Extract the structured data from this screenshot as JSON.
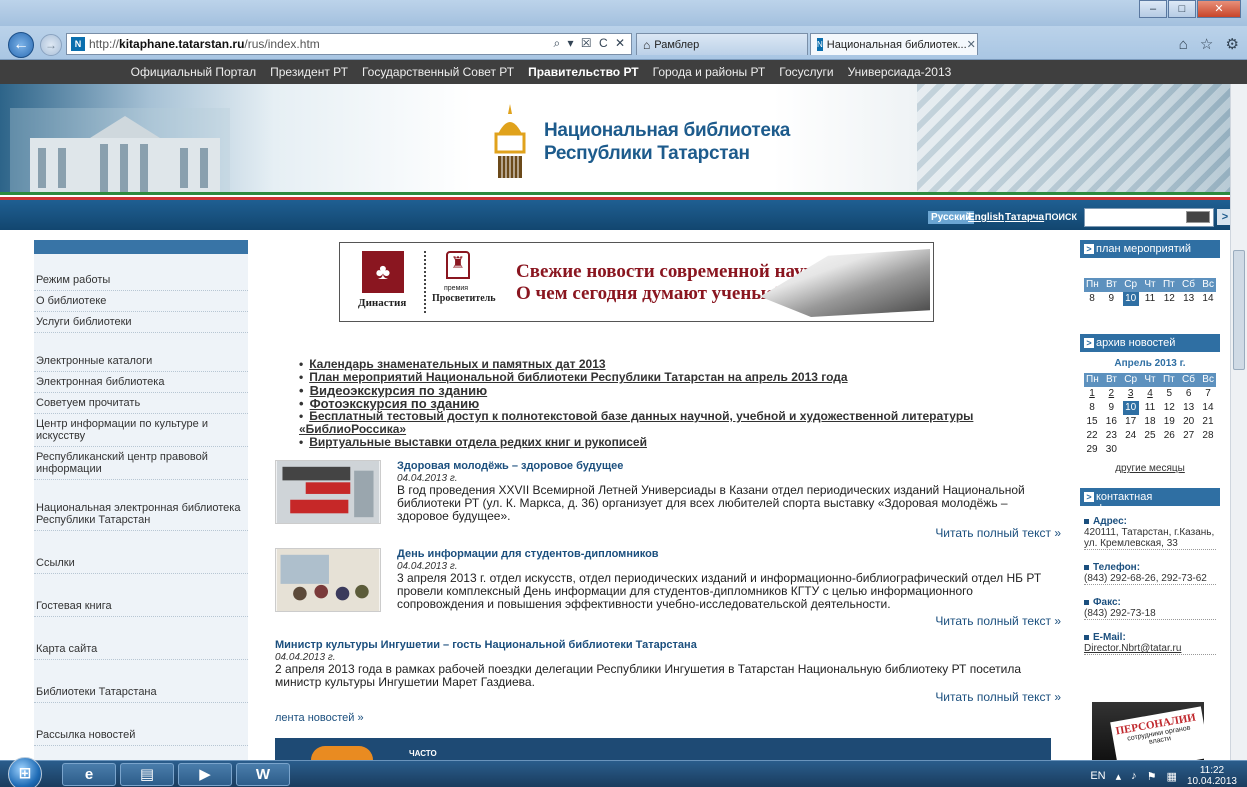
{
  "browser": {
    "url_prefix": "http://",
    "url_host": "kitaphane.tatarstan.ru",
    "url_path": "/rus/index.htm",
    "url_tools": "⌕ ▾ ☒ C ✕",
    "tabs": [
      {
        "label": "Рамблер",
        "active": false
      },
      {
        "label": "Национальная библиотек...",
        "active": true
      }
    ],
    "tab_close": "✕",
    "window_controls": [
      "–",
      "□",
      "✕"
    ],
    "right_icons": "⌂ ☆ ⚙"
  },
  "topnav": {
    "items": [
      "Официальный Портал",
      "Президент РТ",
      "Государственный Совет РТ",
      "Правительство РТ",
      "Города и районы РТ",
      "Госуслуги",
      "Универсиада-2013"
    ],
    "active_index": 3
  },
  "banner": {
    "title_line1": "Национальная библиотека",
    "title_line2": "Республики Татарстан"
  },
  "langbar": {
    "ru": "Русский",
    "en": "English",
    "tt": "Татарча",
    "search_label": "ПОИСК",
    "search_value": "",
    "go": ">"
  },
  "sidebar": {
    "group1": [
      "Режим работы",
      "О библиотеке",
      "Услуги библиотеки"
    ],
    "group2": [
      "Электронные каталоги",
      "Электронная библиотека",
      "Советуем прочитать",
      "Центр информации по культуре и искусству",
      "Республиканский центр правовой информации"
    ],
    "group3": [
      "Национальная электронная библиотека Республики Татарстан"
    ],
    "group4": [
      "Ссылки"
    ],
    "group5": [
      "Гостевая книга"
    ],
    "group6": [
      "Карта сайта"
    ],
    "group7": [
      "Библиотеки Татарстана"
    ],
    "group8": [
      "Рассылка новостей"
    ]
  },
  "promo": {
    "dynasty": "Династия",
    "prize_small": "премия",
    "prize": "Просветитель",
    "headline1": "Свежие новости современной науки.",
    "headline2": "О чем сегодня думают ученые?"
  },
  "links": [
    "Календарь знаменательных и памятных дат 2013",
    "План мероприятий Национальной библиотеки Республики Татарстан на апрель 2013 года",
    "Видеоэкскурсия по зданию",
    "Фотоэкскурсия по зданию",
    "Бесплатный тестовый доступ к полнотекстовой базе данных научной, учебной и художественной литературы «БиблиоРоссика»",
    "Виртуальные выставки отдела редких книг и рукописей"
  ],
  "news": [
    {
      "title": "Здоровая молодёжь – здоровое будущее",
      "date": "04.04.2013 г.",
      "text": "В год проведения XXVII Всемирной Летней Универсиады в Казани отдел периодических изданий Национальной библиотеки РТ (ул. К. Маркса, д. 36) организует для всех любителей спорта выставку «Здоровая молодёжь – здоровое будущее».",
      "more": "Читать полный текст »"
    },
    {
      "title": "День информации для студентов-дипломников",
      "date": "04.04.2013 г.",
      "text": "3 апреля 2013 г. отдел искусств, отдел периодических изданий и информационно-библиографический отдел НБ РТ провели комплексный День информации для студентов-дипломников КГТУ с целью информационного сопровождения и повышения эффективности учебно-исследовательской деятельности.",
      "more": "Читать полный текст »"
    },
    {
      "title": "Министр культуры Ингушетии – гость Национальной библиотеки Татарстана",
      "date": "04.04.2013 г.",
      "text": "2 апреля 2013 года в рамках рабочей поездки делегации Республики Ингушетия в Татарстан Национальную библиотеку РТ посетила министр культуры Ингушетии Марет Газдиева.",
      "more": "Читать полный текст »"
    }
  ],
  "feed_link": "лента новостей »",
  "bottom_banner_label": "ЧАСТО",
  "right": {
    "events_head": "план мероприятий",
    "archive_head": "архив новостей",
    "contacts_head": "контактная информация",
    "weekdays": [
      "Пн",
      "Вт",
      "Ср",
      "Чт",
      "Пт",
      "Сб",
      "Вс"
    ],
    "events_week": [
      "8",
      "9",
      "10",
      "11",
      "12",
      "13",
      "14"
    ],
    "archive_month": "Апрель 2013 г.",
    "archive_weeks": [
      [
        "1",
        "2",
        "3",
        "4",
        "5",
        "6",
        "7"
      ],
      [
        "8",
        "9",
        "10",
        "11",
        "12",
        "13",
        "14"
      ],
      [
        "15",
        "16",
        "17",
        "18",
        "19",
        "20",
        "21"
      ],
      [
        "22",
        "23",
        "24",
        "25",
        "26",
        "27",
        "28"
      ],
      [
        "29",
        "30",
        "",
        "",
        "",
        "",
        ""
      ]
    ],
    "other_months": "другие месяцы",
    "address_label": "Адрес:",
    "address": "420111, Татарстан, г.Казань, ул. Кремлевская, 33",
    "phone_label": "Телефон:",
    "phone": "(843) 292-68-26, 292-73-62",
    "fax_label": "Факс:",
    "fax": "(843) 292-73-18",
    "email_label": "E-Mail:",
    "email": "Director.Nbrt@tatar.ru",
    "pers1": "ПЕРСОНАЛИИ",
    "pers2": "сотрудники органов власти"
  },
  "taskbar": {
    "lang": "EN",
    "time": "11:22",
    "date": "10.04.2013"
  },
  "colors": {
    "site_blue": "#1b4f7e",
    "header_blue": "#2f6fa3",
    "promo_red": "#8a1620",
    "topnav_bg": "#3f3f3f"
  }
}
